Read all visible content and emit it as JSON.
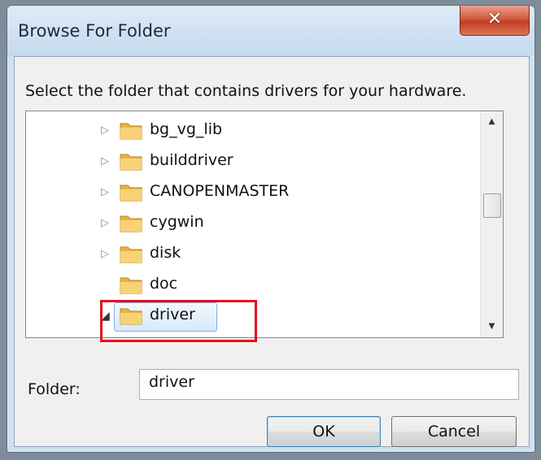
{
  "dialog": {
    "title": "Browse For Folder",
    "close_label": "✕",
    "instruction": "Select the folder that contains drivers for your hardware."
  },
  "tree": {
    "items": [
      {
        "label": "bg_vg_lib",
        "expander": "collapsed"
      },
      {
        "label": "builddriver",
        "expander": "collapsed"
      },
      {
        "label": "CANOPENMASTER",
        "expander": "collapsed"
      },
      {
        "label": "cygwin",
        "expander": "collapsed"
      },
      {
        "label": "disk",
        "expander": "collapsed"
      },
      {
        "label": "doc",
        "expander": "none"
      },
      {
        "label": "driver",
        "expander": "expanded",
        "selected": true
      }
    ]
  },
  "folder_field": {
    "label": "Folder:",
    "value": "driver"
  },
  "buttons": {
    "ok": "OK",
    "cancel": "Cancel"
  },
  "colors": {
    "highlight_box": "#e0141e",
    "folder_icon": "#f2c14b"
  }
}
